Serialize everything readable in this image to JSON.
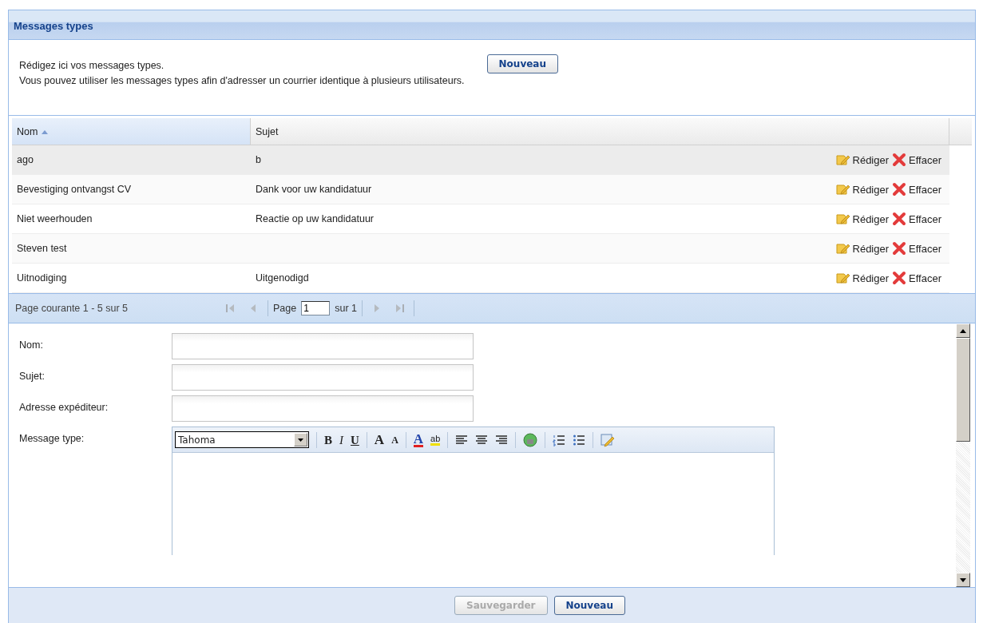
{
  "panel": {
    "title": "Messages types"
  },
  "intro": {
    "lines": [
      "Rédigez ici vos messages types.",
      "Vous pouvez utiliser les messages types afin d'adresser un courrier identique à plusieurs utilisateurs."
    ],
    "button": {
      "label": "Nouveau",
      "disabled": false
    }
  },
  "table": {
    "columns": [
      {
        "label": "Nom",
        "sorted": true
      },
      {
        "label": "Sujet",
        "sorted": false
      }
    ],
    "rows": [
      {
        "nom": "ago",
        "sujet": "b",
        "selected": true,
        "actions": [
          "Rédiger",
          "Effacer"
        ]
      },
      {
        "nom": "Bevestiging ontvangst CV",
        "sujet": "Dank voor uw kandidatuur",
        "selected": false,
        "actions": [
          "Rédiger",
          "Effacer"
        ]
      },
      {
        "nom": "Niet weerhouden",
        "sujet": "Reactie op uw kandidatuur",
        "selected": false,
        "actions": [
          "Rédiger",
          "Effacer"
        ]
      },
      {
        "nom": "Steven test",
        "sujet": "",
        "selected": false,
        "actions": [
          "Rédiger",
          "Effacer"
        ]
      },
      {
        "nom": "Uitnodiging",
        "sujet": "Uitgenodigd",
        "selected": false,
        "actions": [
          "Rédiger",
          "Effacer"
        ]
      }
    ]
  },
  "pager": {
    "summary": "Page courante 1 - 5 sur 5",
    "page_label": "Page",
    "page_value": "1",
    "of_label": "sur 1",
    "buttons": [
      {
        "kind": "first",
        "disabled": true
      },
      {
        "kind": "prev",
        "disabled": true
      },
      {
        "kind": "next",
        "disabled": true
      },
      {
        "kind": "last",
        "disabled": true
      }
    ]
  },
  "form": {
    "fields": [
      {
        "label": "Nom:"
      },
      {
        "label": "Sujet:"
      },
      {
        "label": "Adresse expéditeur:"
      }
    ],
    "editor": {
      "label": "Message type:",
      "font": "Tahoma",
      "toolbar": [
        {
          "kind": "bold",
          "label": "B"
        },
        {
          "kind": "italic",
          "label": "I"
        },
        {
          "kind": "underline",
          "label": "U"
        },
        {
          "kind": "sep"
        },
        {
          "kind": "grow",
          "label": "A"
        },
        {
          "kind": "shrink",
          "label": "A"
        },
        {
          "kind": "sep"
        },
        {
          "kind": "fontcolor",
          "label": "A"
        },
        {
          "kind": "highlight",
          "label": "ab"
        },
        {
          "kind": "sep"
        },
        {
          "kind": "align-left"
        },
        {
          "kind": "align-center"
        },
        {
          "kind": "align-right"
        },
        {
          "kind": "sep"
        },
        {
          "kind": "image"
        },
        {
          "kind": "sep"
        },
        {
          "kind": "ordered-list"
        },
        {
          "kind": "bullet-list"
        },
        {
          "kind": "sep"
        },
        {
          "kind": "source"
        }
      ]
    }
  },
  "footer": {
    "buttons": [
      {
        "label": "Sauvegarder",
        "disabled": true
      },
      {
        "label": "Nouveau",
        "disabled": false
      }
    ]
  }
}
